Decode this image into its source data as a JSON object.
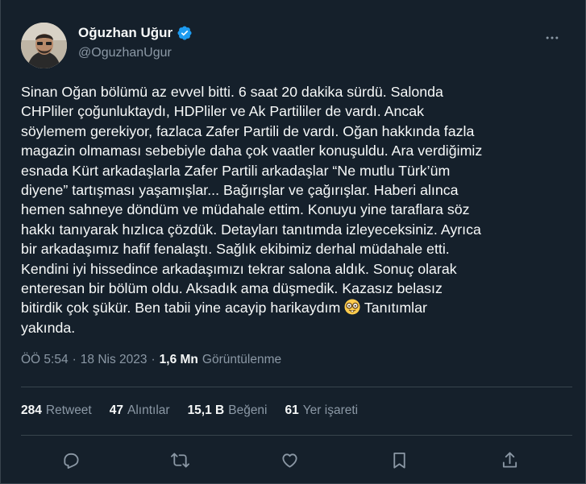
{
  "author": {
    "display_name": "Oğuzhan Uğur",
    "handle": "@OguzhanUgur",
    "verified_icon": "verified-badge-icon",
    "avatar": "avatar-photo"
  },
  "tweet": {
    "text": "Sinan Oğan bölümü az evvel bitti. 6 saat 20 dakika sürdü. Salonda\nCHPliler çoğunluktaydı, HDPliler ve Ak Partililer de vardı. Ancak\nsöylemem gerekiyor, fazlaca Zafer Partili de vardı. Oğan hakkında fazla\nmagazin olmaması sebebiyle daha çok vaatler konuşuldu. Ara verdiğimiz\nesnada Kürt arkadaşlarla Zafer Partili arkadaşlar “Ne mutlu Türk’üm\ndiyene” tartışması yaşamışlar... Bağırışlar ve çağırışlar. Haberi alınca\nhemen sahneye döndüm ve müdahale ettim. Konuyu yine taraflara söz\nhakkı tanıyarak hızlıca çözdük. Detayları tanıtımda izleyeceksiniz. Ayrıca\nbir arkadaşımız hafif fenalaştı. Sağlık ekibimiz derhal müdahale etti.\nKendini iyi hissedince  arkadaşımızı tekrar salona aldık. Sonuç olarak\nenteresan bir bölüm oldu. Aksadık ama düşmedik. Kazasız belasız\nbitirdik çok şükür. Ben tabii yine acayip harikaydım ",
    "text_after_emoji": " Tanıtımlar\nyakında.",
    "emoji_icon": "nerd-face-emoji"
  },
  "meta": {
    "time": "ÖÖ 5:54",
    "sep1": "·",
    "date": "18 Nis 2023",
    "sep2": "·",
    "views_count": "1,6 Mn",
    "views_label": "Görüntülenme"
  },
  "stats": {
    "retweets": {
      "count": "284",
      "label": "Retweet"
    },
    "quotes": {
      "count": "47",
      "label": "Alıntılar"
    },
    "likes": {
      "count": "15,1 B",
      "label": "Beğeni"
    },
    "bookmarks": {
      "count": "61",
      "label": "Yer işareti"
    }
  },
  "actions": [
    "reply-icon",
    "retweet-icon",
    "like-icon",
    "bookmark-icon",
    "share-icon"
  ],
  "colors": {
    "background": "#15202b",
    "text": "#f7f9f9",
    "secondary_text": "#8b98a5",
    "divider": "#38444d",
    "verified": "#1d9bf0"
  }
}
